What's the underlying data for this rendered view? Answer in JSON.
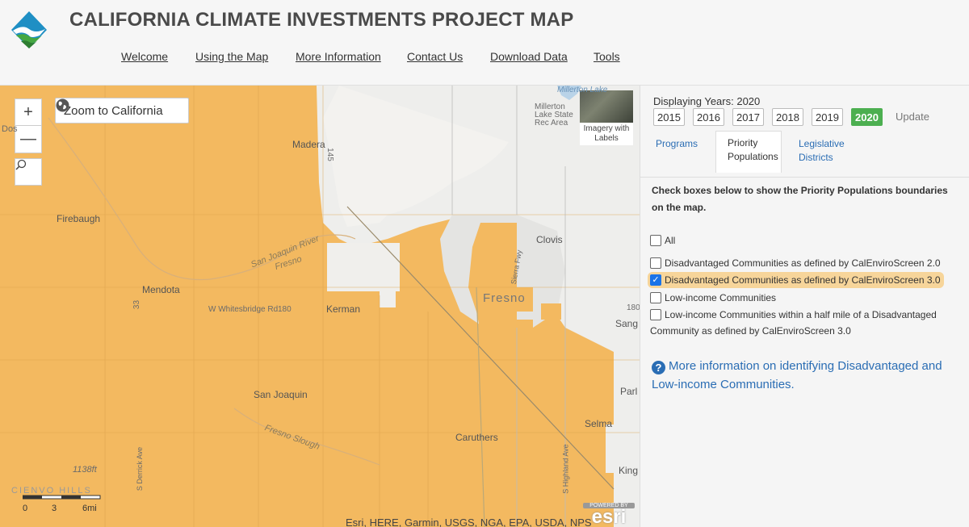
{
  "header": {
    "title": "CALIFORNIA CLIMATE INVESTMENTS PROJECT MAP",
    "nav": [
      "Welcome",
      "Using the Map",
      "More Information",
      "Contact Us",
      "Download Data",
      "Tools"
    ]
  },
  "map": {
    "zoom_in": "+",
    "zoom_out": "—",
    "zoom_to_ca": "Zoom to California",
    "basemap_label": "Imagery with Labels",
    "labels": {
      "millerton_lake": "Millerton Lake",
      "millerton_sra": "Millerton Lake State Rec Area",
      "madera": "Madera",
      "firebaugh": "Firebaugh",
      "clovis": "Clovis",
      "san_joaquin_river": "San Joaquin River",
      "fresno_small": "Fresno",
      "mendota": "Mendota",
      "w_whitesbridge": "W Whitesbridge Rd",
      "rd180_left": "180",
      "rd180_right": "180",
      "kerman": "Kerman",
      "fresno": "Fresno",
      "sanger": "Sang",
      "san_joaquin": "San Joaquin",
      "parlier": "Parl",
      "fresno_slough": "Fresno Slough",
      "selma": "Selma",
      "caruthers": "Caruthers",
      "hwy33": "33",
      "hwy145": "145",
      "ft1138": "1138ft",
      "cienvo_hills": "CIENVO HILLS",
      "s_derrick": "S Derrick Ave",
      "s_highland": "S Highland Ave",
      "kings": "King",
      "serra": "Sierra Fwy",
      "dos": "Dos"
    },
    "scale": [
      "0",
      "3",
      "6mi"
    ],
    "attribution": "Esri, HERE, Garmin, USGS, NGA, EPA, USDA, NPS",
    "powered_by": "POWERED BY",
    "esri": "esri"
  },
  "panel": {
    "years_label": "Displaying Years: 2020",
    "years": [
      "2015",
      "2016",
      "2017",
      "2018",
      "2019",
      "2020"
    ],
    "active_year": "2020",
    "update": "Update",
    "tabs": {
      "programs": "Programs",
      "priority": "Priority Populations",
      "legislative": "Legislative Districts"
    },
    "instructions": "Check boxes below to show the Priority Populations boundaries on the map.",
    "checkboxes": [
      {
        "label": "All",
        "checked": false
      },
      {
        "label": "Disadvantaged Communities as defined by CalEnviroScreen 2.0",
        "checked": false
      },
      {
        "label": "Disadvantaged Communities as defined by CalEnviroScreen 3.0",
        "checked": true
      },
      {
        "label": "Low-income Communities",
        "checked": false
      },
      {
        "label": "Low-income Communities within a half mile of a Disadvantaged Community as defined by CalEnviroScreen 3.0",
        "checked": false
      }
    ],
    "info_link": "More information on identifying Disadvantaged and Low-income Communities."
  },
  "colors": {
    "dac_fill": "#f3b960",
    "active_year": "#4caf50",
    "link": "#2a6db4",
    "highlight": "#f7d59a"
  }
}
